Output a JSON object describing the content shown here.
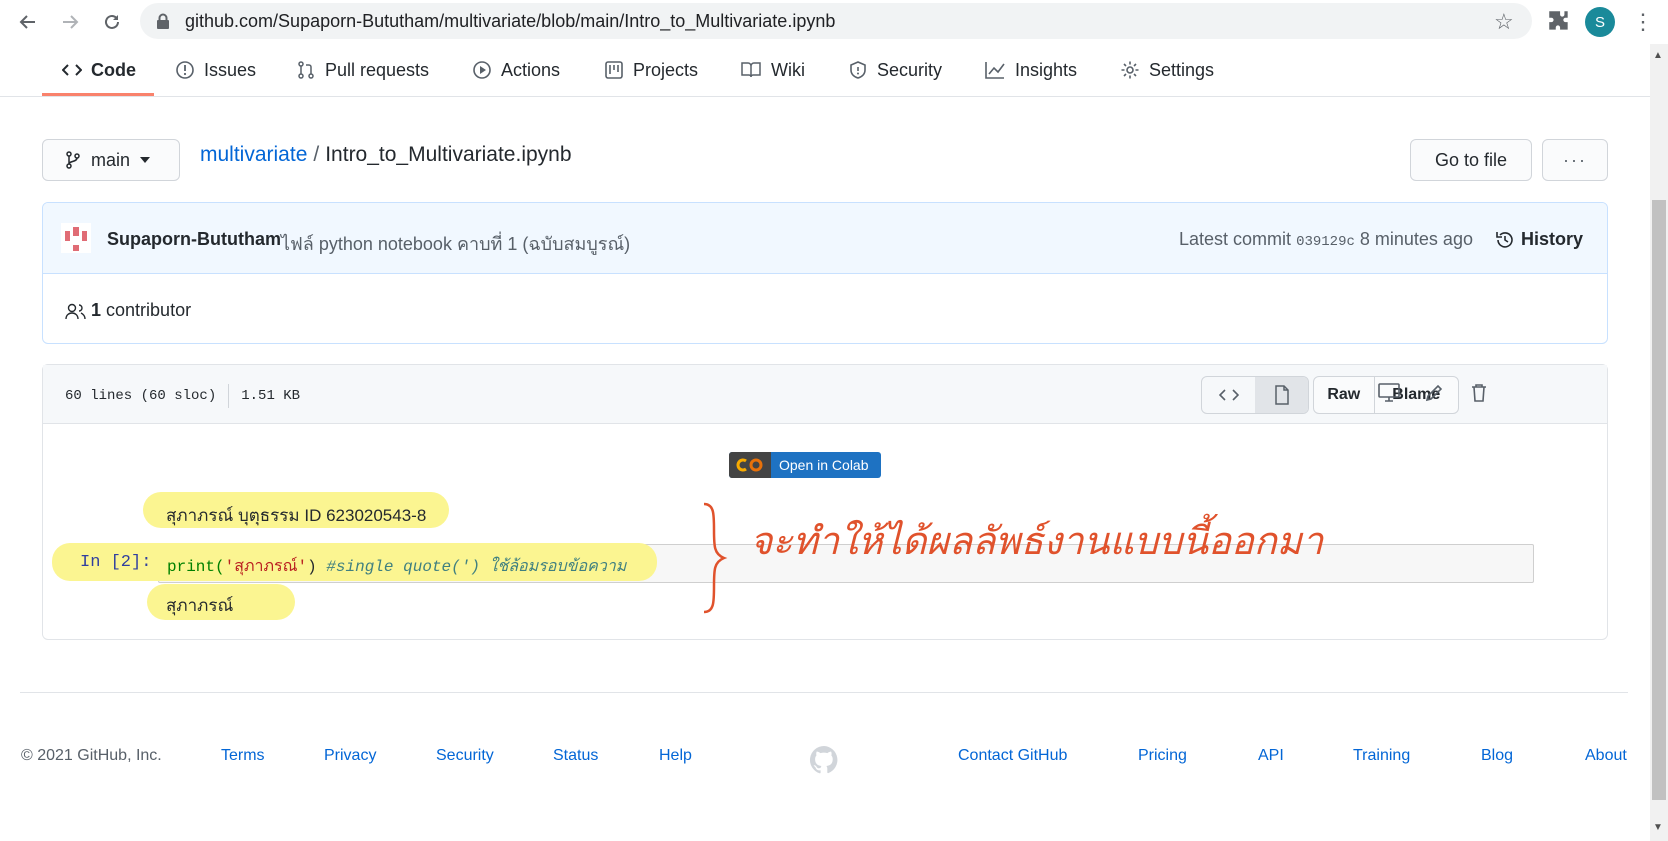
{
  "browser": {
    "url": "github.com/Supaporn-Bututham/multivariate/blob/main/Intro_to_Multivariate.ipynb",
    "avatar_letter": "S"
  },
  "repo_tabs": [
    {
      "label": "Code",
      "icon": "code-icon",
      "active": true
    },
    {
      "label": "Issues",
      "icon": "issue-icon"
    },
    {
      "label": "Pull requests",
      "icon": "pull-request-icon"
    },
    {
      "label": "Actions",
      "icon": "play-icon"
    },
    {
      "label": "Projects",
      "icon": "project-icon"
    },
    {
      "label": "Wiki",
      "icon": "book-icon"
    },
    {
      "label": "Security",
      "icon": "shield-icon"
    },
    {
      "label": "Insights",
      "icon": "graph-icon"
    },
    {
      "label": "Settings",
      "icon": "gear-icon"
    }
  ],
  "breadcrumb": {
    "branch": "main",
    "repo": "multivariate",
    "separator": "/",
    "file": "Intro_to_Multivariate.ipynb",
    "go_to_file": "Go to file",
    "more": "···"
  },
  "commit": {
    "author": "Supaporn-Bututham",
    "message": "ไฟล์ python notebook คาบที่ 1 (ฉบับสมบูรณ์)",
    "latest_label": "Latest commit",
    "sha": "039129c",
    "time": "8 minutes ago",
    "history_label": "History",
    "contributors_count": "1",
    "contributors_label": "contributor"
  },
  "file": {
    "lines": "60 lines (60 sloc)",
    "size": "1.51 KB",
    "raw_label": "Raw",
    "blame_label": "Blame"
  },
  "notebook": {
    "colab_label": "Open in Colab",
    "name_line": "สุภาภรณ์ บุตุธรรม ID 623020543-8",
    "in_prompt": "In [2]:",
    "code_fn": "print(",
    "code_str": "'สุภาภรณ์'",
    "code_close": ") ",
    "code_comment": "#single quote(') ใช้ล้อมรอบข้อความ",
    "output": "สุภาภรณ์",
    "annotation": "จะทำให้ได้ผลลัพธ์งานแบบนี้ออกมา",
    "highlight_color": "#fbf591",
    "annotation_color": "#e0522c"
  },
  "footer": {
    "copyright": "© 2021 GitHub, Inc.",
    "left_links": [
      "Terms",
      "Privacy",
      "Security",
      "Status",
      "Help"
    ],
    "right_links": [
      "Contact GitHub",
      "Pricing",
      "API",
      "Training",
      "Blog",
      "About"
    ]
  }
}
